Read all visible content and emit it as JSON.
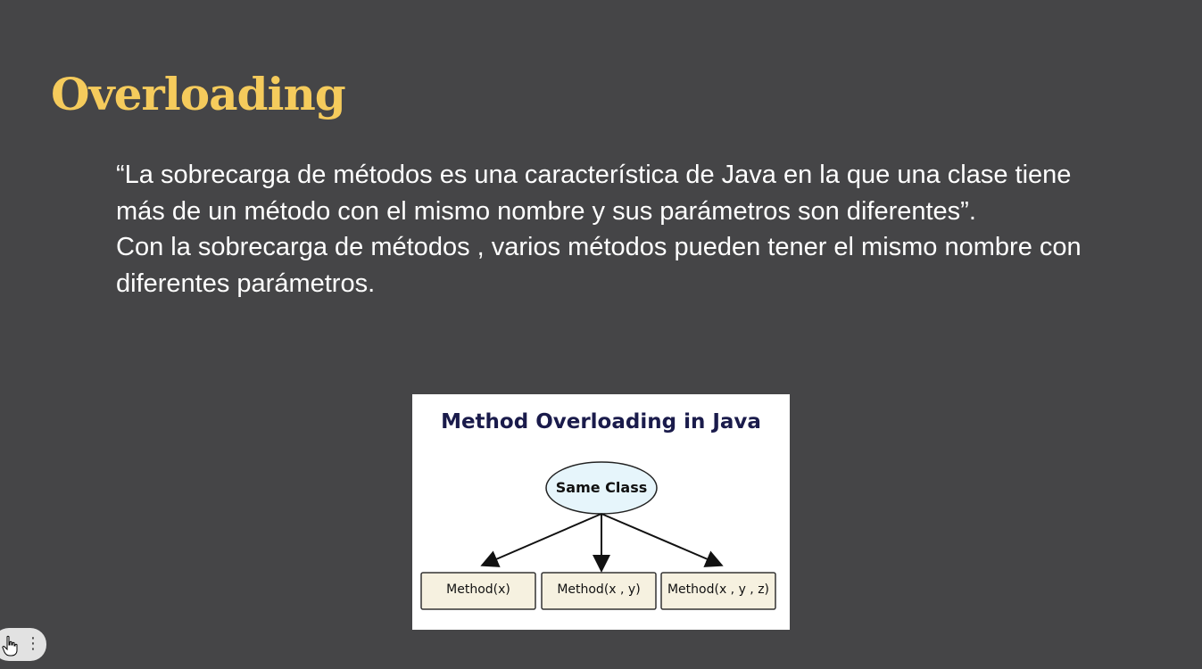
{
  "slide": {
    "title": "Overloading",
    "paragraph_1": "“La sobrecarga de métodos es una característica de Java en la que una clase tiene más de un método con el mismo nombre y sus parámetros son diferentes”.",
    "paragraph_2": "Con la sobrecarga de métodos , varios métodos pueden tener el mismo nombre con diferentes parámetros."
  },
  "diagram": {
    "title": "Method Overloading in Java",
    "class_node": "Same Class",
    "methods": [
      "Method(x)",
      "Method(x , y)",
      "Method(x , y , z)"
    ]
  },
  "controls": {
    "cursor_icon": "hand-pointer-icon",
    "menu_icon": "more-vertical-icon"
  },
  "colors": {
    "background": "#454547",
    "title": "#f5cb5c",
    "body_text": "#ffffff",
    "diagram_title": "#1a1b4b",
    "ellipse_fill": "#e6f5fb",
    "method_box_fill": "#f6f1e0"
  }
}
